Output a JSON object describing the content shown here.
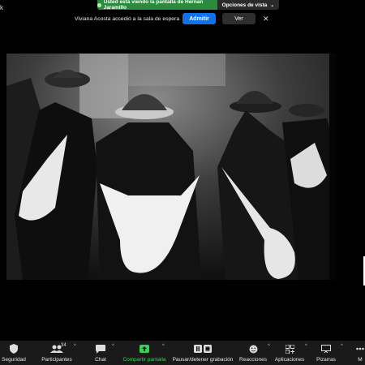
{
  "top_left_label": "k",
  "banner": {
    "sharing_text": "Usted está viendo la pantalla de Hernan Jaramillo",
    "view_options": "Opciones de vista"
  },
  "waiting_room": {
    "message": "Viviana Acosta accedió a la sala de espera",
    "admit": "Admitir",
    "see": "Ver"
  },
  "colors": {
    "accent": "#0e72ed",
    "share_green": "#2b8a3e",
    "toolbar_bg": "#1a1a1a"
  },
  "toolbar": {
    "security": "Seguridad",
    "participants": "Participantes",
    "participants_count": "34",
    "chat": "Chat",
    "share": "Compartir pantalla",
    "record": "Pausar/detener grabación",
    "reactions": "Reacciones",
    "apps": "Aplicaciones",
    "whiteboards": "Pizarras",
    "more": "M"
  }
}
